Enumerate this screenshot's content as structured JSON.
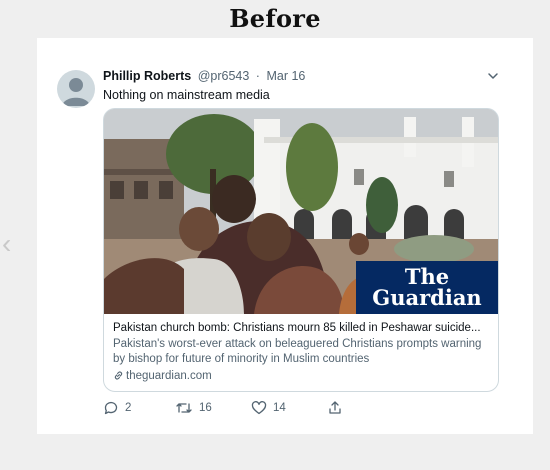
{
  "page": {
    "heading": "Before"
  },
  "nav": {
    "prev_glyph": "‹"
  },
  "tweet": {
    "author_name": "Phillip Roberts",
    "handle": "@pr6543",
    "separator": "·",
    "date": "Mar 16",
    "text": "Nothing on mainstream media",
    "card": {
      "logo_line1": "The",
      "logo_line2": "Guardian",
      "title": "Pakistan church bomb: Christians mourn 85 killed in Peshawar suicide...",
      "description": "Pakistan's worst-ever attack on beleaguered Christians prompts warning by bishop for future of minority in Muslim countries",
      "domain": "theguardian.com"
    },
    "actions": {
      "reply_count": "2",
      "retweet_count": "16",
      "like_count": "14"
    }
  },
  "colors": {
    "guardian_blue": "#052962",
    "text_primary": "#0f1419",
    "text_secondary": "#536471"
  },
  "icons": [
    "chevron-down-icon",
    "reply-icon",
    "retweet-icon",
    "like-icon",
    "share-icon",
    "link-icon"
  ]
}
